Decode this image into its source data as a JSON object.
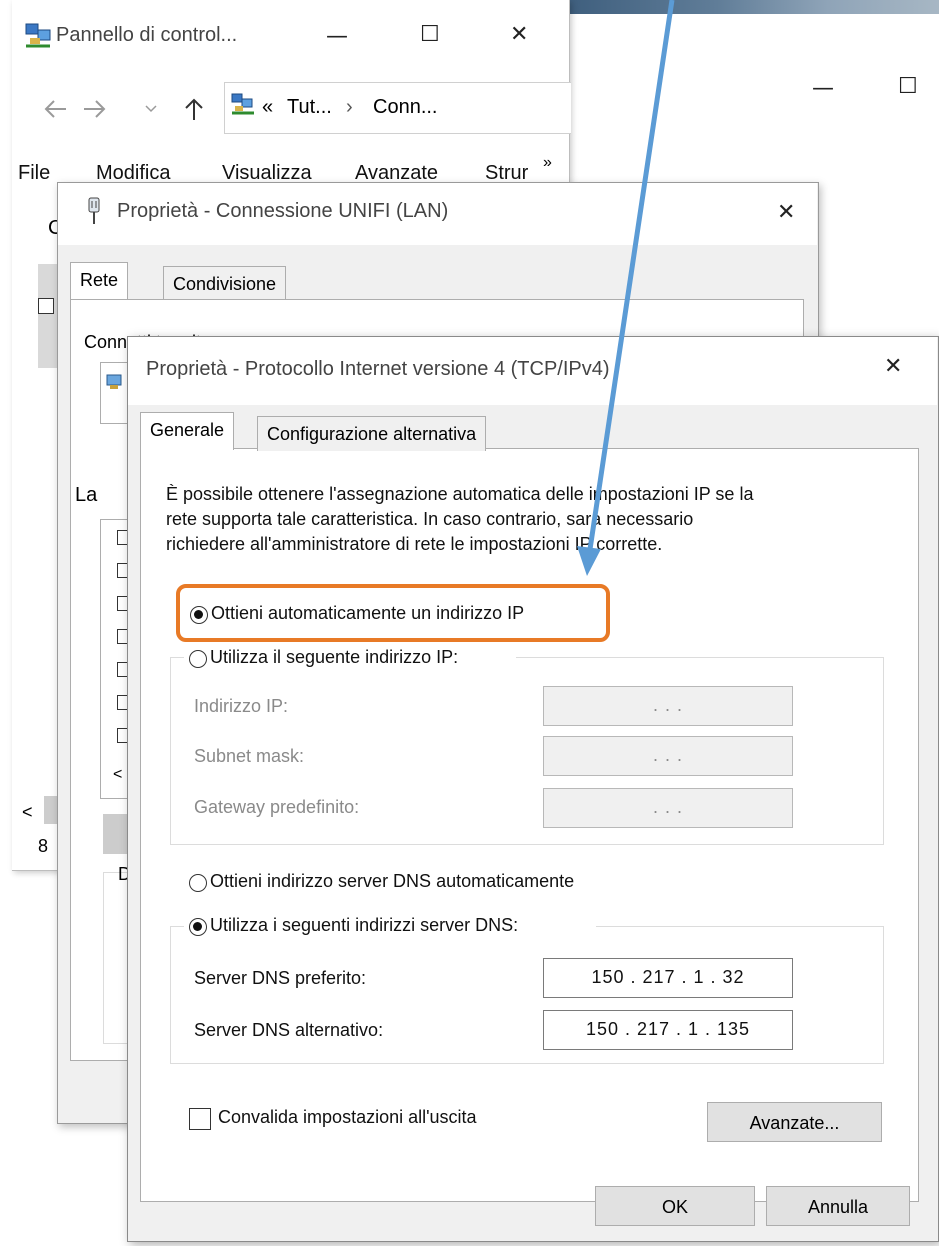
{
  "background": {
    "window2_controls": {
      "minimize": "—",
      "maximize": "☐"
    }
  },
  "control_panel": {
    "title": "Pannello di control...",
    "controls": {
      "minimize": "—",
      "maximize": "☐",
      "close": "✕"
    },
    "breadcrumb": {
      "prefix": "«",
      "part1": "Tut...",
      "sep": "›",
      "part2": "Conn..."
    },
    "menu": [
      "File",
      "Modifica",
      "Visualizza",
      "Avanzate",
      "Strur"
    ],
    "menu_more": "»",
    "partial_left_letters": {
      "c": "C",
      "la": "La",
      "scroll_left": "<",
      "count": "8",
      "d": "D"
    }
  },
  "properties_window": {
    "title": "Proprietà - Connessione UNIFI (LAN)",
    "close": "✕",
    "tabs": [
      "Rete",
      "Condivisione"
    ],
    "connect_label_partial": "Connetti tramite:"
  },
  "tcp_dialog": {
    "title": "Proprietà - Protocollo Internet versione 4 (TCP/IPv4)",
    "close": "✕",
    "tabs": [
      "Generale",
      "Configurazione alternativa"
    ],
    "description_lines": [
      "È possibile ottenere l'assegnazione automatica delle impostazioni IP se la",
      "rete supporta tale caratteristica. In caso contrario, sarà necessario",
      "richiedere all'amministratore di rete le impostazioni IP corrette."
    ],
    "ip_auto_label": "Ottieni automaticamente un indirizzo IP",
    "ip_manual_label": "Utilizza il seguente indirizzo IP:",
    "ip_fields": [
      {
        "label": "Indirizzo IP:",
        "value": ""
      },
      {
        "label": "Subnet mask:",
        "value": ""
      },
      {
        "label": "Gateway predefinito:",
        "value": ""
      }
    ],
    "dns_auto_label": "Ottieni indirizzo server DNS automaticamente",
    "dns_manual_label": "Utilizza i seguenti indirizzi server DNS:",
    "dns_fields": [
      {
        "label": "Server DNS preferito:",
        "value": "150 . 217 .  1  . 32"
      },
      {
        "label": "Server DNS alternativo:",
        "value": "150 . 217 .  1  . 135"
      }
    ],
    "ip_mode": "automatic",
    "dns_mode": "manual",
    "validate_label": "Convalida impostazioni all'uscita",
    "validate_checked": false,
    "advanced_button": "Avanzate...",
    "ok_button": "OK",
    "cancel_button": "Annulla",
    "empty_ip_placeholder": ".   .   ."
  },
  "annotation": {
    "highlight_color": "#e87a26",
    "arrow_color": "#5b9bd5"
  }
}
